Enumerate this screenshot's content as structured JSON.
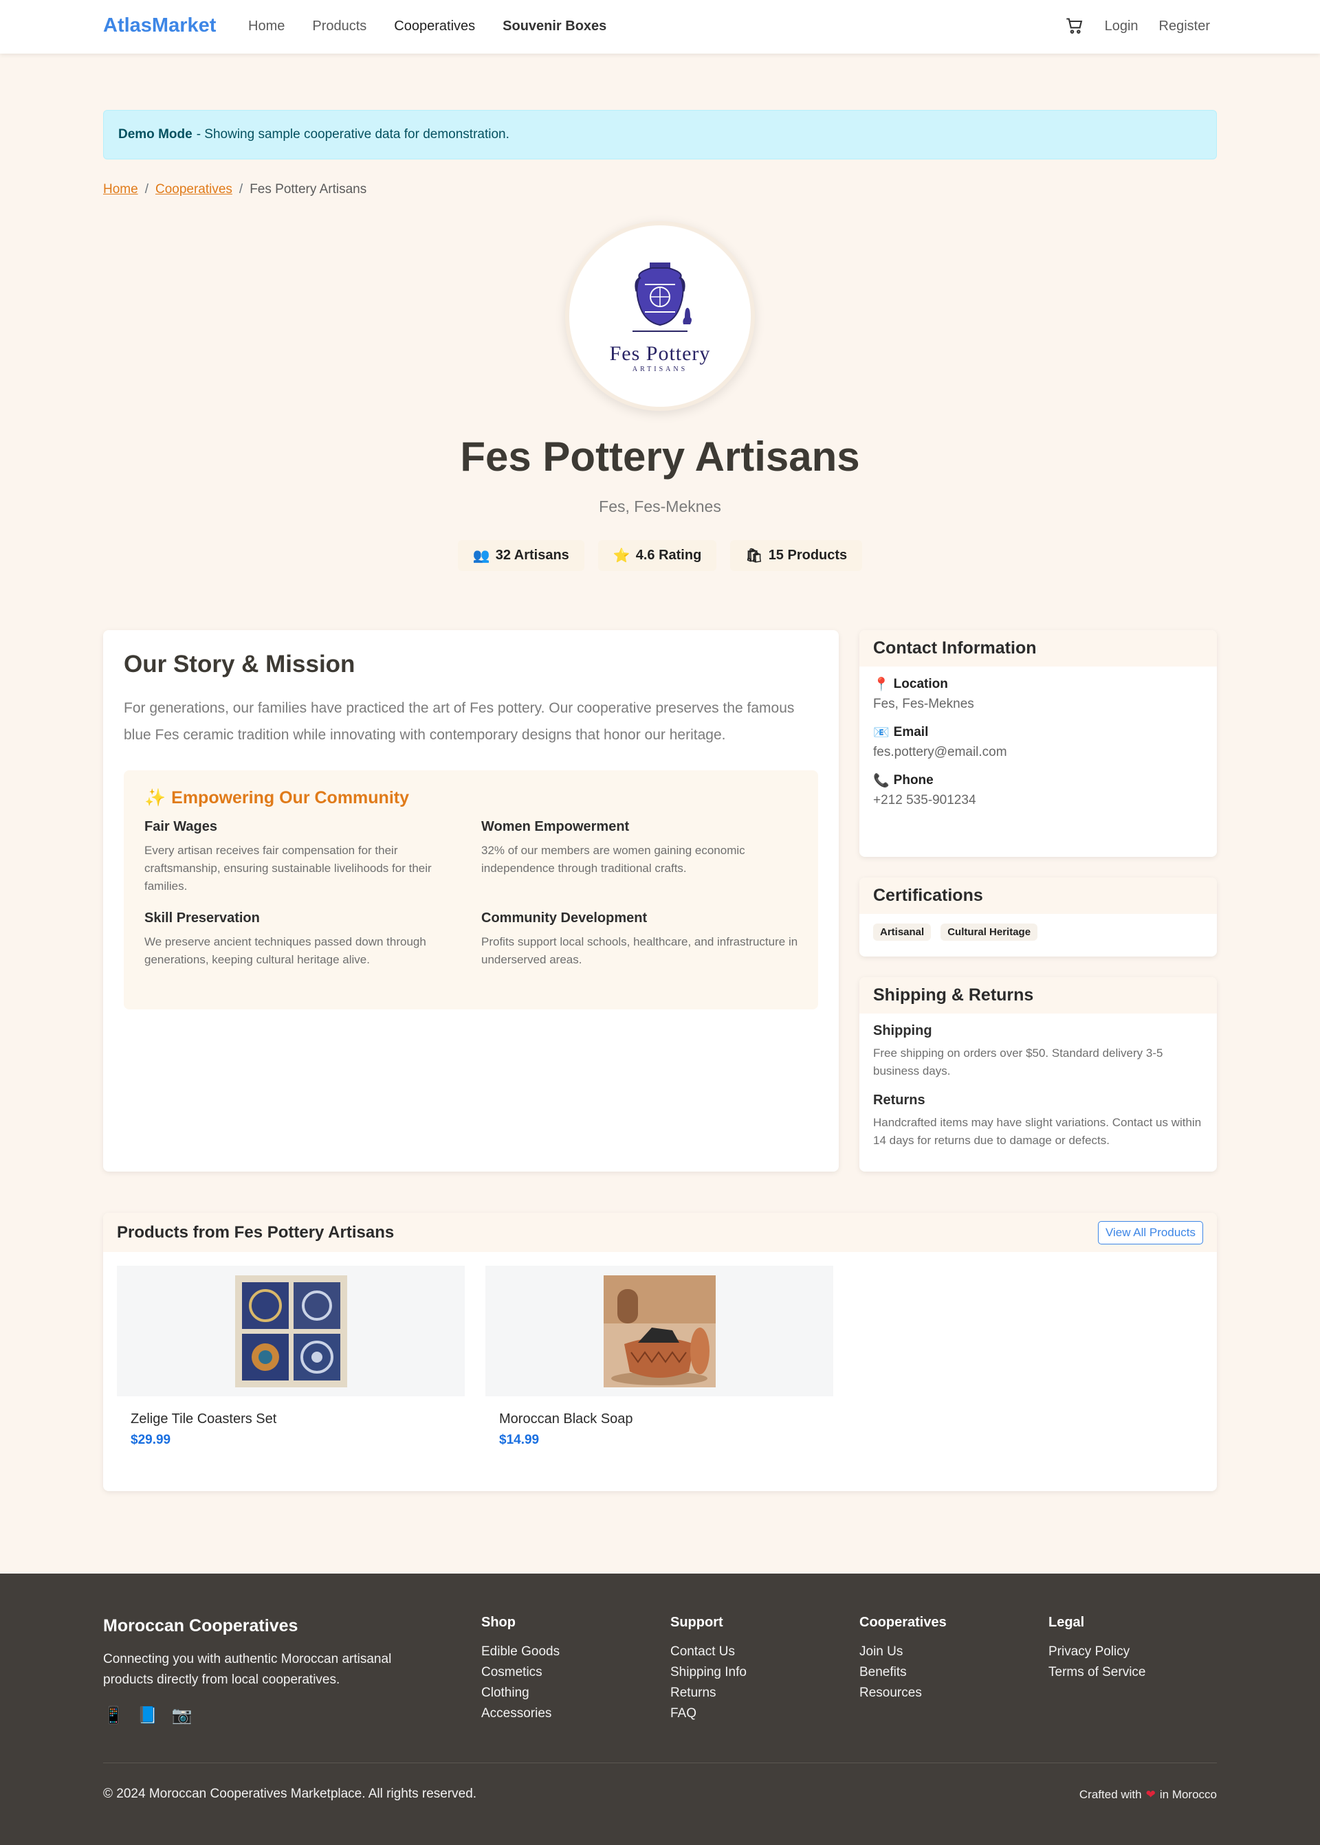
{
  "nav": {
    "brand": "AtlasMarket",
    "links": [
      "Home",
      "Products",
      "Cooperatives",
      "Souvenir Boxes"
    ],
    "login": "Login",
    "register": "Register"
  },
  "alert": {
    "strong": "Demo Mode",
    "text": "- Showing sample cooperative data for demonstration."
  },
  "breadcrumb": [
    "Home",
    "Cooperatives",
    "Fes Pottery Artisans"
  ],
  "logo": {
    "name": "Fes Pottery",
    "sub": "ARTISANS"
  },
  "coop": {
    "name": "Fes Pottery Artisans",
    "location": "Fes, Fes-Meknes",
    "stats": [
      "32 Artisans",
      "4.6 Rating",
      "15 Products"
    ]
  },
  "story": {
    "title": "Our Story & Mission",
    "text": "For generations, our families have practiced the art of Fes pottery. Our cooperative preserves the famous blue Fes ceramic tradition while innovating with contemporary designs that honor our heritage.",
    "empower_title": "Empowering Our Community",
    "items": [
      {
        "title": "Fair Wages",
        "desc": "Every artisan receives fair compensation for their craftsmanship, ensuring sustainable livelihoods for their families."
      },
      {
        "title": "Women Empowerment",
        "desc": "32% of our members are women gaining economic independence through traditional crafts."
      },
      {
        "title": "Skill Preservation",
        "desc": "We preserve ancient techniques passed down through generations, keeping cultural heritage alive."
      },
      {
        "title": "Community Development",
        "desc": "Profits support local schools, healthcare, and infrastructure in underserved areas."
      }
    ]
  },
  "contact": {
    "title": "Contact Information",
    "location_label": "Location",
    "location": "Fes, Fes-Meknes",
    "email_label": "Email",
    "email": "fes.pottery@email.com",
    "phone_label": "Phone",
    "phone": "+212 535-901234"
  },
  "certifications": {
    "title": "Certifications",
    "items": [
      "Artisanal",
      "Cultural Heritage"
    ]
  },
  "shipping": {
    "title": "Shipping & Returns",
    "shipping_title": "Shipping",
    "shipping_text": "Free shipping on orders over $50. Standard delivery 3-5 business days.",
    "returns_title": "Returns",
    "returns_text": "Handcrafted items may have slight variations. Contact us within 14 days for returns due to damage or defects."
  },
  "products": {
    "title": "Products from Fes Pottery Artisans",
    "view_all": "View All Products",
    "items": [
      {
        "name": "Zelige Tile Coasters Set",
        "price": "$29.99"
      },
      {
        "name": "Moroccan Black Soap",
        "price": "$14.99"
      }
    ]
  },
  "footer": {
    "brand": "Moroccan Cooperatives",
    "desc": "Connecting you with authentic Moroccan artisanal products directly from local cooperatives.",
    "columns": [
      {
        "title": "Shop",
        "links": [
          "Edible Goods",
          "Cosmetics",
          "Clothing",
          "Accessories"
        ]
      },
      {
        "title": "Support",
        "links": [
          "Contact Us",
          "Shipping Info",
          "Returns",
          "FAQ"
        ]
      },
      {
        "title": "Cooperatives",
        "links": [
          "Join Us",
          "Benefits",
          "Resources"
        ]
      },
      {
        "title": "Legal",
        "links": [
          "Privacy Policy",
          "Terms of Service"
        ]
      }
    ],
    "copyright": "© 2024 Moroccan Cooperatives Marketplace. All rights reserved.",
    "crafted_pre": "Crafted with",
    "crafted_post": "in Morocco"
  },
  "colors": {
    "brand": "#3d86e6",
    "accent_orange": "#e07b1a",
    "price_blue": "#1a6fe0",
    "footer_bg": "#423e3a",
    "page_bg": "#fcf5ee"
  }
}
